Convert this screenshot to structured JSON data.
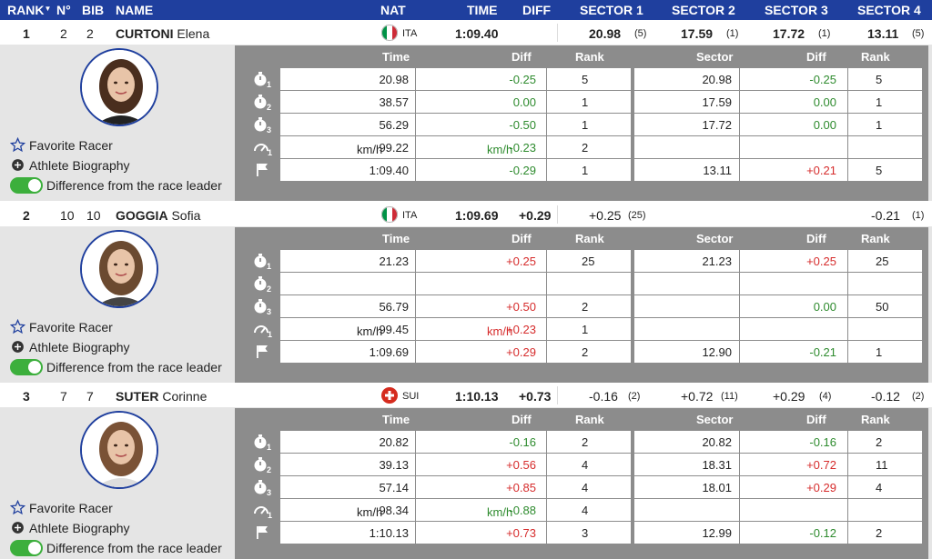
{
  "header": {
    "rank": "RANK",
    "no": "N°",
    "bib": "BIB",
    "name": "NAME",
    "nat": "NAT",
    "time": "TIME",
    "diff": "DIFF",
    "sector1": "SECTOR 1",
    "sector2": "SECTOR 2",
    "sector3": "SECTOR 3",
    "sector4": "SECTOR 4"
  },
  "panel_header": {
    "time": "Time",
    "diff": "Diff",
    "rank": "Rank",
    "sector": "Sector",
    "sdiff": "Diff",
    "srank": "Rank"
  },
  "links": {
    "favorite": "Favorite Racer",
    "bio": "Athlete Biography",
    "difference": "Difference from the race leader"
  },
  "colors": {
    "header_bg": "#1f3f9e",
    "positive": "#d62c2c",
    "negative": "#2e8b2e",
    "toggle": "#3caf3c"
  },
  "kmh_unit": "km/h",
  "racers": [
    {
      "rank": "1",
      "no": "2",
      "bib": "2",
      "last": "CURTONI",
      "first": "Elena",
      "nat": "ITA",
      "flag": "italy-flag",
      "time": "1:09.40",
      "diff": "",
      "sectors": [
        {
          "value": "20.98",
          "rank": "(5)"
        },
        {
          "value": "17.59",
          "rank": "(1)"
        },
        {
          "value": "17.72",
          "rank": "(1)"
        },
        {
          "value": "13.11",
          "rank": "(5)"
        }
      ],
      "rows": [
        {
          "time": "20.98",
          "diff": "-0.25",
          "rank": "5",
          "sector": "20.98",
          "sdiff": "-0.25",
          "srank": "5"
        },
        {
          "time": "38.57",
          "diff": "0.00",
          "rank": "1",
          "sector": "17.59",
          "sdiff": "0.00",
          "srank": "1"
        },
        {
          "time": "56.29",
          "diff": "-0.50",
          "rank": "1",
          "sector": "17.72",
          "sdiff": "0.00",
          "srank": "1"
        },
        {
          "time": "99.22",
          "diff": "-0.23",
          "rank": "2",
          "sector": "",
          "sdiff": "",
          "srank": "",
          "speed": true
        },
        {
          "time": "1:09.40",
          "diff": "-0.29",
          "rank": "1",
          "sector": "13.11",
          "sdiff": "+0.21",
          "srank": "5"
        }
      ]
    },
    {
      "rank": "2",
      "no": "10",
      "bib": "10",
      "last": "GOGGIA",
      "first": "Sofia",
      "nat": "ITA",
      "flag": "italy-flag",
      "time": "1:09.69",
      "diff": "+0.29",
      "sectors": [
        {
          "value": "+0.25",
          "rank": "(25)"
        },
        {
          "value": "",
          "rank": ""
        },
        {
          "value": "",
          "rank": ""
        },
        {
          "value": "-0.21",
          "rank": "(1)"
        }
      ],
      "rows": [
        {
          "time": "21.23",
          "diff": "+0.25",
          "rank": "25",
          "sector": "21.23",
          "sdiff": "+0.25",
          "srank": "25"
        },
        {
          "time": "",
          "diff": "",
          "rank": "",
          "sector": "",
          "sdiff": "",
          "srank": ""
        },
        {
          "time": "56.79",
          "diff": "+0.50",
          "rank": "2",
          "sector": "",
          "sdiff": "0.00",
          "srank": "50"
        },
        {
          "time": "99.45",
          "diff": "+0.23",
          "rank": "1",
          "sector": "",
          "sdiff": "",
          "srank": "",
          "speed": true
        },
        {
          "time": "1:09.69",
          "diff": "+0.29",
          "rank": "2",
          "sector": "12.90",
          "sdiff": "-0.21",
          "srank": "1"
        }
      ]
    },
    {
      "rank": "3",
      "no": "7",
      "bib": "7",
      "last": "SUTER",
      "first": "Corinne",
      "nat": "SUI",
      "flag": "swiss-flag",
      "time": "1:10.13",
      "diff": "+0.73",
      "sectors": [
        {
          "value": "-0.16",
          "rank": "(2)"
        },
        {
          "value": "+0.72",
          "rank": "(11)"
        },
        {
          "value": "+0.29",
          "rank": "(4)"
        },
        {
          "value": "-0.12",
          "rank": "(2)"
        }
      ],
      "rows": [
        {
          "time": "20.82",
          "diff": "-0.16",
          "rank": "2",
          "sector": "20.82",
          "sdiff": "-0.16",
          "srank": "2"
        },
        {
          "time": "39.13",
          "diff": "+0.56",
          "rank": "4",
          "sector": "18.31",
          "sdiff": "+0.72",
          "srank": "11"
        },
        {
          "time": "57.14",
          "diff": "+0.85",
          "rank": "4",
          "sector": "18.01",
          "sdiff": "+0.29",
          "srank": "4"
        },
        {
          "time": "98.34",
          "diff": "-0.88",
          "rank": "4",
          "sector": "",
          "sdiff": "",
          "srank": "",
          "speed": true
        },
        {
          "time": "1:10.13",
          "diff": "+0.73",
          "rank": "3",
          "sector": "12.99",
          "sdiff": "-0.12",
          "srank": "2"
        }
      ]
    }
  ]
}
